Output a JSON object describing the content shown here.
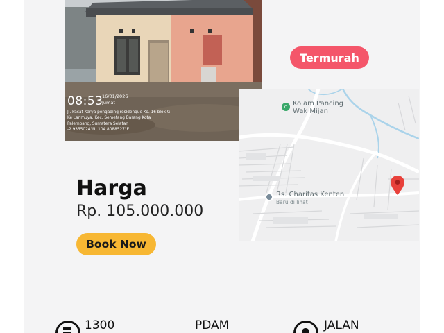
{
  "photo": {
    "stamp_time": "08:53",
    "stamp_date": "16/01/2026",
    "stamp_day": "Jumat",
    "stamp_address": "Jl. Pacat Karya pengading residenque Ko. 16 blok G Ke Lanmuya. Kec. Semetang Barang Kota Palembang, Sumatera Selatan",
    "stamp_coords": "-2.9355024\"N, 104.8088527\"E"
  },
  "badge": {
    "label": "Termurah"
  },
  "map": {
    "poi_top": "Kolam Pancing\nWak Mijan",
    "poi_top_line1": "Kolam Pancing",
    "poi_top_line2": "Wak Mijan",
    "poi_hospital": "Rs. Charitas Kenten",
    "poi_hospital_sub": "Baru di lihat"
  },
  "price": {
    "title": "Harga",
    "value": "Rp. 105.000.000"
  },
  "cta": {
    "label": "Book Now"
  },
  "features": [
    {
      "icon": "electricity-icon",
      "label": "1300"
    },
    {
      "icon": "",
      "label": "PDAM"
    },
    {
      "icon": "road-icon",
      "label": "JALAN"
    }
  ],
  "colors": {
    "badge": "#f4566a",
    "cta": "#f7b733",
    "card_background": "#f4f4f5",
    "map_pin": "#e8413b"
  }
}
